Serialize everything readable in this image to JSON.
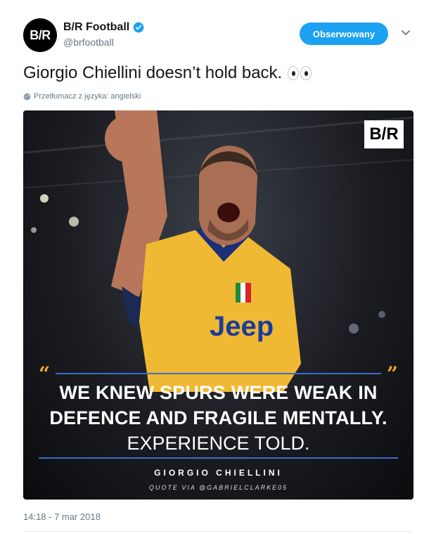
{
  "account": {
    "display_name": "B/R Football",
    "handle": "@brfootball",
    "avatar_text": "B/R",
    "verified_icon": "verified-badge-icon"
  },
  "follow_button": {
    "label": "Obserwowany",
    "color": "#1da1f2"
  },
  "tweet": {
    "text": "Giorgio Chiellini doesn’t hold back.",
    "emoji": "eyes"
  },
  "translate": {
    "label": "Przetłumacz z języka: angielski"
  },
  "media": {
    "logo_text": "B/R",
    "quote_lines": [
      "WE KNEW SPURS WERE WEAK IN",
      "DEFENCE AND FRAGILE MENTALLY.",
      "EXPERIENCE TOLD."
    ],
    "attribution": "GIORGIO CHIELLINI",
    "credit": "QUOTE VIA @GABRIELCLARKE05",
    "accent_color": "#f5a623",
    "rule_color": "#3c6bd1"
  },
  "timestamp": "14:18 - 7 mar 2018"
}
